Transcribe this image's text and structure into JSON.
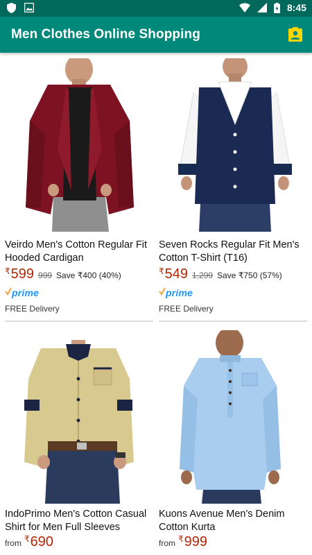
{
  "status_bar": {
    "time": "8:45"
  },
  "app_bar": {
    "title": "Men Clothes Online Shopping",
    "action_icon": "contacts-badge-icon",
    "accent_color": "#00897b",
    "icon_color": "#ffd600"
  },
  "products": [
    {
      "title": "Veirdo Men's Cotton Regular Fit Hooded Cardigan",
      "currency": "₹",
      "price": "599",
      "mrp": "999",
      "save": "Save ₹400 (40%)",
      "prime": "prime",
      "delivery": "FREE Delivery"
    },
    {
      "title": "Seven Rocks Regular Fit Men's Cotton T-Shirt (T16)",
      "currency": "₹",
      "price": "549",
      "mrp": "1,299",
      "save": "Save ₹750 (57%)",
      "prime": "prime",
      "delivery": "FREE Delivery"
    },
    {
      "title": "IndoPrimo Men's Cotton Casual Shirt for Men Full Sleeves",
      "from": "from",
      "currency": "₹",
      "price": "690"
    },
    {
      "title": "Kuons Avenue Men's Denim Cotton Kurta",
      "from": "from",
      "currency": "₹",
      "price": "999"
    }
  ]
}
